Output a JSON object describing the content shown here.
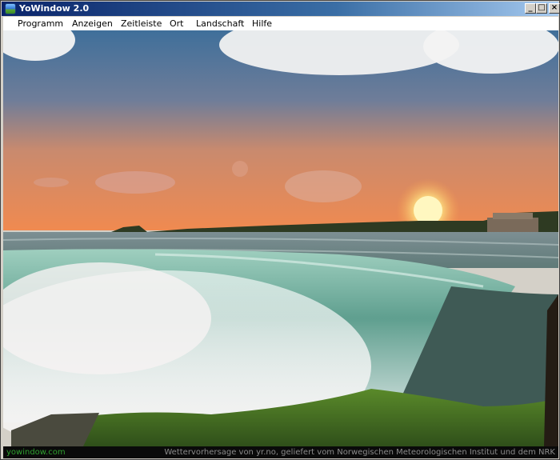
{
  "window": {
    "title": "YoWindow 2.0",
    "minimize_glyph": "_",
    "maximize_glyph": "□",
    "close_glyph": "×"
  },
  "menu": {
    "items": [
      {
        "label": "Programm"
      },
      {
        "label": "Anzeigen"
      },
      {
        "label": "Zeitleiste"
      },
      {
        "label": "Ort"
      },
      {
        "label": "Landschaft"
      },
      {
        "label": "Hilfe"
      }
    ]
  },
  "status": {
    "link": "yowindow.com",
    "credit": "Wettervorhersage von yr.no, geliefert vom Norwegischen Meteorologischen Institut und dem NRK"
  },
  "colors": {
    "title_gradient_start": "#0a246a",
    "status_link": "#2fa02f",
    "status_credit": "#8a8a8a"
  }
}
